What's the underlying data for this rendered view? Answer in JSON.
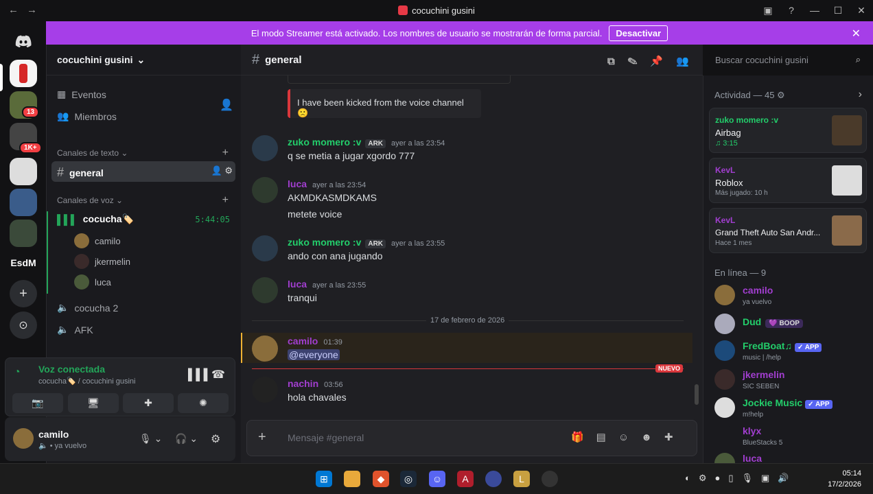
{
  "window": {
    "title": "cocuchini gusini"
  },
  "banner": {
    "text": "El modo Streamer está activado. Los nombres de usuario se mostrarán de forma parcial.",
    "button": "Desactivar"
  },
  "servers": {
    "badge1": "13",
    "badge2": "1K+",
    "esdm": "EsdM"
  },
  "sidebar": {
    "server_name": "cocuchini gusini",
    "events": "Eventos",
    "members": "Miembros",
    "text_category": "Canales de texto",
    "channel_general": "general",
    "voice_category": "Canales de voz",
    "voice_channel1": "cocucha🏷️",
    "voice_timer": "5:44:05",
    "voice_users": [
      "camilo",
      "jkermelin",
      "luca"
    ],
    "voice_channel2": "cocucha 2",
    "voice_channel3": "AFK"
  },
  "voice_panel": {
    "status": "Voz conectada",
    "location": "cocucha🏷️ / cocuchini gusini"
  },
  "user_panel": {
    "name": "camilo",
    "status": "ya vuelvo"
  },
  "chat": {
    "channel": "general",
    "embed_text": "I have been kicked from the voice channel",
    "messages": [
      {
        "name": "zuko momero :v",
        "tag": "ARK",
        "time": "ayer a las 23:54",
        "lines": [
          "q se metia a jugar xgordo 777"
        ]
      },
      {
        "name": "luca",
        "tag": "",
        "time": "ayer a las 23:54",
        "lines": [
          "AKMDKASMDKAMS",
          "metete voice"
        ]
      },
      {
        "name": "zuko momero :v",
        "tag": "ARK",
        "time": "ayer a las 23:55",
        "lines": [
          "ando con ana jugando"
        ]
      },
      {
        "name": "luca",
        "tag": "",
        "time": "ayer a las 23:55",
        "lines": [
          "tranqui"
        ]
      },
      {
        "name": "camilo",
        "tag": "",
        "time": "01:39",
        "lines": [
          "@everyone"
        ]
      },
      {
        "name": "nachin",
        "tag": "",
        "time": "03:56",
        "lines": [
          "hola chavales"
        ]
      }
    ],
    "divider_date": "17 de febrero de 2026",
    "new_label": "NUEVO",
    "composer_placeholder": "Mensaje #general"
  },
  "search": {
    "placeholder": "Buscar cocuchini gusini"
  },
  "activity": {
    "header": "Actividad — 45",
    "cards": [
      {
        "user": "zuko momero :v",
        "title": "Airbag",
        "sub": "♫ 3:15"
      },
      {
        "user": "KevL",
        "title": "Roblox",
        "sub": "Más jugado: 10 h"
      },
      {
        "user": "KevL",
        "title": "Grand Theft Auto San Andr...",
        "sub": "Hace 1 mes"
      }
    ]
  },
  "online": {
    "header": "En línea — 9",
    "members": [
      {
        "name": "camilo",
        "status": "ya vuelvo",
        "app": ""
      },
      {
        "name": "Dud",
        "status": "",
        "app": "",
        "pill": "💜 BOOP"
      },
      {
        "name": "FredBoat♫",
        "status": "music | /help",
        "app": "✓ APP"
      },
      {
        "name": "jkermelin",
        "status": "SIC SEBEN",
        "app": ""
      },
      {
        "name": "Jockie Music",
        "status": "m!help",
        "app": "✓ APP"
      },
      {
        "name": "klyx",
        "status": "BlueStacks 5",
        "app": ""
      },
      {
        "name": "luca",
        "status": "",
        "app": ""
      }
    ]
  },
  "taskbar": {
    "time": "05:14",
    "date": "17/2/2026"
  },
  "colors": {
    "banner": "#a63ee8",
    "green_name": "#3ba55d",
    "purple_name": "#a23ed0"
  }
}
